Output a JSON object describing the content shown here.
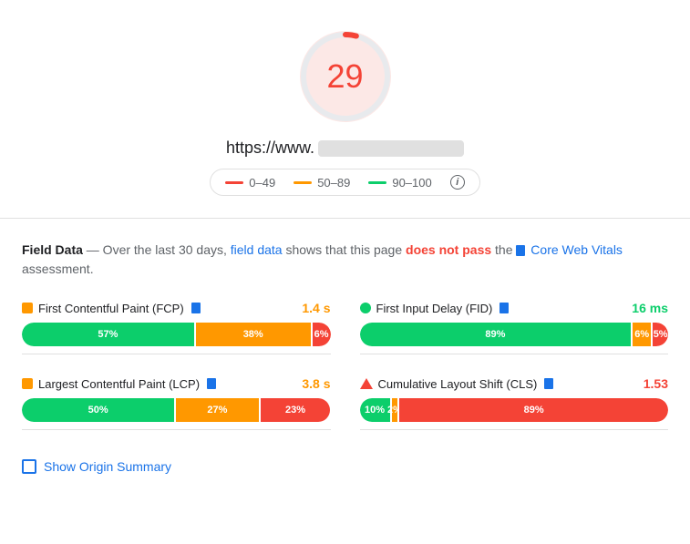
{
  "score": {
    "value": "29",
    "color": "#f44336",
    "gauge_bg": "#fce8e6"
  },
  "url": {
    "prefix": "https://www.",
    "masked": true
  },
  "legend": {
    "ranges": [
      {
        "label": "0–49",
        "color": "red",
        "dot_color": "#f44336"
      },
      {
        "label": "50–89",
        "color": "orange",
        "dot_color": "#ff9800"
      },
      {
        "label": "90–100",
        "color": "green",
        "dot_color": "#0cce6b"
      }
    ],
    "info_label": "i"
  },
  "field_data": {
    "title": "Field Data",
    "description_pre": "— Over the last 30 days, ",
    "link_text": "field data",
    "description_mid": " shows that this page ",
    "fail_text": "does not pass",
    "description_post": " the ",
    "cwv_text": "Core Web Vitals",
    "description_end": " assessment."
  },
  "metrics": [
    {
      "id": "fcp",
      "icon_type": "orange_square",
      "title": "First Contentful Paint (FCP)",
      "badge": true,
      "value": "1.4 s",
      "value_color": "orange",
      "bar": [
        {
          "pct": 57,
          "label": "57%",
          "type": "green"
        },
        {
          "pct": 38,
          "label": "38%",
          "type": "orange"
        },
        {
          "pct": 6,
          "label": "6%",
          "type": "red"
        }
      ]
    },
    {
      "id": "fid",
      "icon_type": "green_circle",
      "title": "First Input Delay (FID)",
      "badge": true,
      "value": "16 ms",
      "value_color": "green",
      "bar": [
        {
          "pct": 89,
          "label": "89%",
          "type": "green"
        },
        {
          "pct": 6,
          "label": "6%",
          "type": "orange"
        },
        {
          "pct": 5,
          "label": "5%",
          "type": "red"
        }
      ]
    },
    {
      "id": "lcp",
      "icon_type": "orange_square",
      "title": "Largest Contentful Paint (LCP)",
      "badge": true,
      "value": "3.8 s",
      "value_color": "orange",
      "bar": [
        {
          "pct": 50,
          "label": "50%",
          "type": "green"
        },
        {
          "pct": 27,
          "label": "27%",
          "type": "orange"
        },
        {
          "pct": 23,
          "label": "23%",
          "type": "red"
        }
      ]
    },
    {
      "id": "cls",
      "icon_type": "red_triangle",
      "title": "Cumulative Layout Shift (CLS)",
      "badge": true,
      "value": "1.53",
      "value_color": "red",
      "bar": [
        {
          "pct": 10,
          "label": "10%",
          "type": "green"
        },
        {
          "pct": 2,
          "label": "2%",
          "type": "orange"
        },
        {
          "pct": 89,
          "label": "89%",
          "type": "red"
        }
      ]
    }
  ],
  "origin_summary": {
    "label": "Show Origin Summary"
  }
}
